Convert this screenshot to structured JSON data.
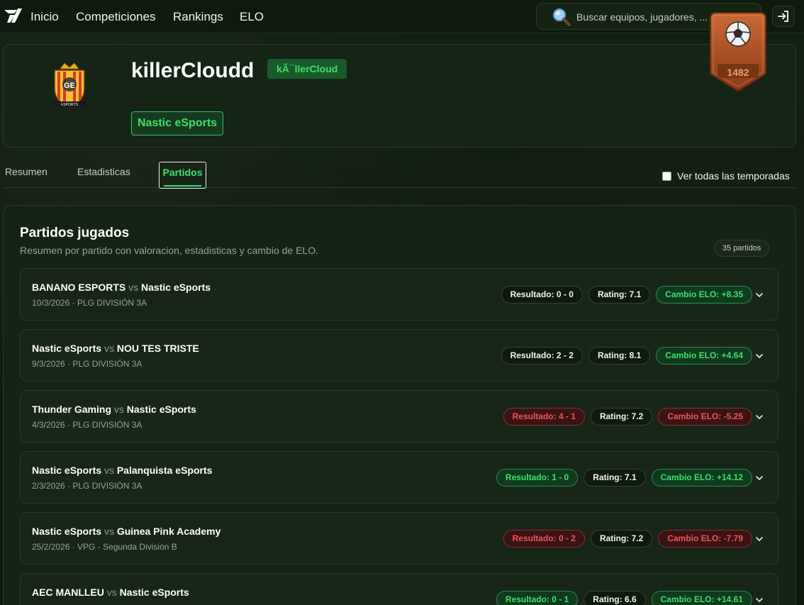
{
  "nav": {
    "links": [
      "Inicio",
      "Competiciones",
      "Rankings",
      "ELO"
    ],
    "search_placeholder": "Buscar equipos, jugadores, ..."
  },
  "profile": {
    "username": "killerCloudd",
    "gamertag": "kÃ¯llerCloud",
    "team": "Nastic eSports",
    "elo": "1482"
  },
  "tabs": {
    "items": [
      "Resumen",
      "Estadisticas",
      "Partidos"
    ],
    "active": "Partidos",
    "season_toggle_label": "Ver todas las temporadas"
  },
  "matches_panel": {
    "title": "Partidos jugados",
    "subtitle": "Resumen por partido con valoracion, estadisticas y cambio de ELO.",
    "count": "35 partidos"
  },
  "matches": [
    {
      "home": "BANANO ESPORTS",
      "vs": "vs",
      "away": "Nastic eSports",
      "meta": "10/3/2026 · PLG DIVISIÓN 3A",
      "result": "Resultado: 0 - 0",
      "result_status": "neutral",
      "rating": "Rating: 7.1",
      "elo": "Cambio ELO: +8.35",
      "elo_status": "win"
    },
    {
      "home": "Nastic eSports",
      "vs": "vs",
      "away": "NOU TES TRISTE",
      "meta": "9/3/2026 · PLG DIVISIÓN 3A",
      "result": "Resultado: 2 - 2",
      "result_status": "neutral",
      "rating": "Rating: 8.1",
      "elo": "Cambio ELO: +4.64",
      "elo_status": "win"
    },
    {
      "home": "Thunder Gaming",
      "vs": "vs",
      "away": "Nastic eSports",
      "meta": "4/3/2026 · PLG DIVISIÓN 3A",
      "result": "Resultado: 4 - 1",
      "result_status": "loss",
      "rating": "Rating: 7.2",
      "elo": "Cambio ELO: -5.25",
      "elo_status": "loss"
    },
    {
      "home": "Nastic eSports",
      "vs": "vs",
      "away": "Palanquista eSports",
      "meta": "2/3/2026 · PLG DIVISIÓN 3A",
      "result": "Resultado: 1 - 0",
      "result_status": "win",
      "rating": "Rating: 7.1",
      "elo": "Cambio ELO: +14.12",
      "elo_status": "win"
    },
    {
      "home": "Nastic eSports",
      "vs": "vs",
      "away": "Guinea Pink Academy",
      "meta": "25/2/2026 · VPG - Segunda División B",
      "result": "Resultado: 0 - 2",
      "result_status": "loss",
      "rating": "Rating: 7.2",
      "elo": "Cambio ELO: -7.79",
      "elo_status": "loss"
    },
    {
      "home": "AEC MANLLEU",
      "vs": "vs",
      "away": "Nastic eSports",
      "meta": "",
      "result": "Resultado: 0 - 1",
      "result_status": "win",
      "rating": "Rating: 6.6",
      "elo": "Cambio ELO: +14.61",
      "elo_status": "win"
    }
  ],
  "colors": {
    "accent": "#3ee06a",
    "loss": "#f05454",
    "elo_badge": "#b5582a"
  }
}
